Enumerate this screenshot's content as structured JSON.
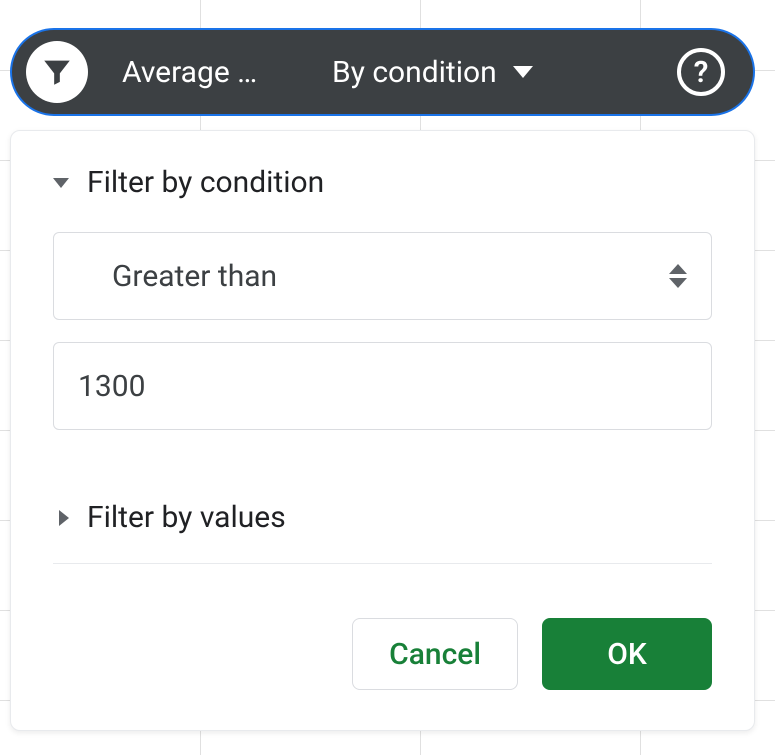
{
  "slicer": {
    "column_label": "Average …",
    "condition_label": "By condition"
  },
  "filter_panel": {
    "section_condition_label": "Filter by condition",
    "condition_selected": "Greater than",
    "condition_value": "1300",
    "section_values_label": "Filter by values",
    "cancel_label": "Cancel",
    "ok_label": "OK"
  },
  "colors": {
    "pill_bg": "#3c4043",
    "accent_green": "#188038",
    "select_ring": "#1a73e8"
  }
}
